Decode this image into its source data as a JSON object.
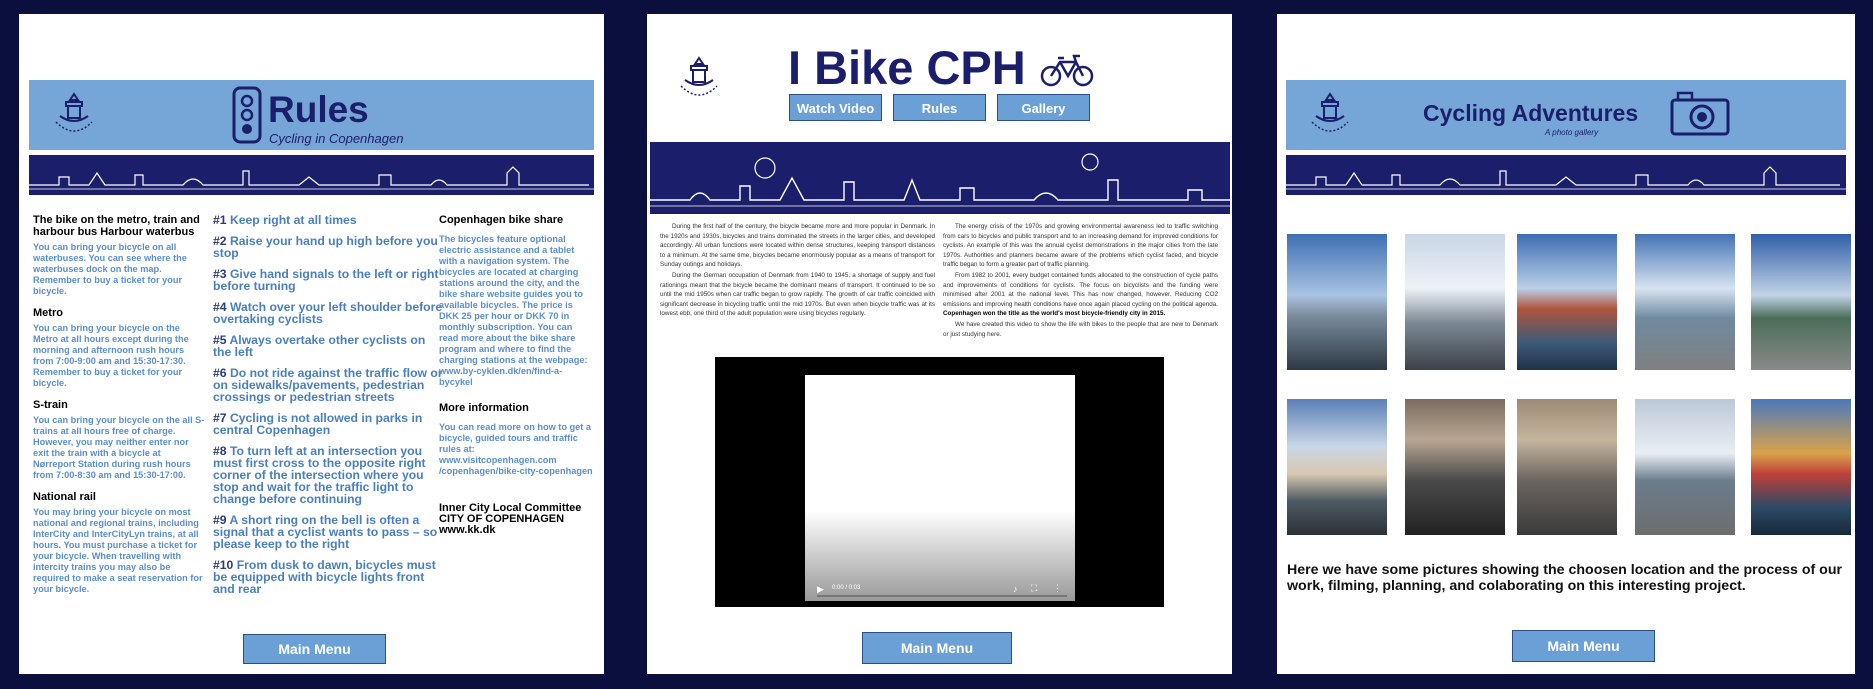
{
  "rules_page": {
    "title": "Rules",
    "subtitle": "Cycling in Copenhagen",
    "left_sections": [
      {
        "title": "The bike on the metro, train and harbour bus Harbour waterbus",
        "body": "You can bring your bicycle on all waterbuses. You can see where the waterbuses dock on the map. Remember to buy a ticket for your bicycle."
      },
      {
        "title": "Metro",
        "body": "You can bring your bicycle on the Metro at all hours except during the morning and afternoon rush hours from 7:00-9:00 am and 15:30-17:30. Remember to buy a ticket for your bicycle."
      },
      {
        "title": "S-train",
        "body": "You can bring your bicycle on the all S-trains at all hours free of charge. However, you may neither enter nor exit the train with a bicycle at Nørreport Station during rush hours from 7:00-8:30 am and 15:30-17:00."
      },
      {
        "title": "National rail",
        "body": "You may bring your bicycle on most national and regional trains, including InterCity and InterCityLyn trains, at all hours. You must purchase a ticket for your bicycle. When travelling with intercity trains you may also be required to make a seat reservation for your bicycle."
      }
    ],
    "rules": [
      {
        "num": "#1",
        "text": "Keep right at all times"
      },
      {
        "num": "#2",
        "text": "Raise your hand up high before you stop"
      },
      {
        "num": "#3",
        "text": "Give hand signals to the left or right before turning"
      },
      {
        "num": "#4",
        "text": "Watch over your left shoulder before overtaking cyclists"
      },
      {
        "num": "#5",
        "text": "Always overtake other cyclists on the left"
      },
      {
        "num": "#6",
        "text": "Do not ride against the traffic flow or on sidewalks/pavements, pedestrian crossings or pedestrian streets"
      },
      {
        "num": "#7",
        "text": "Cycling is not allowed in parks in central Copenhagen"
      },
      {
        "num": "#8",
        "text": "To turn left at an intersection you must first cross to the opposite right corner of the intersection where you stop and wait for the traffic light to change before continuing"
      },
      {
        "num": "#9",
        "text": "A short ring on the bell is often a signal that a cyclist wants to pass – so please keep to the right"
      },
      {
        "num": "#10",
        "text": "From dusk to dawn, bicycles must be equipped with bicycle lights front and rear"
      }
    ],
    "bike_share_title": "Copenhagen bike share",
    "bike_share_body": "The bicycles feature optional electric assistance and a tablet with a navigation system. The bicycles are located at charging stations around the city, and the bike share website guides you to available bicycles. The price is DKK 25 per hour or DKK 70 in monthly subscription. You can read more about the bike share program and where to find the charging stations at the webpage: www.by-cyklen.dk/en/find-a-bycykel",
    "more_info_title": "More information",
    "more_info_body": "You can read more on how to get a bicycle, guided tours and traffic rules at: www.visitcopenhagen.com /copenhagen/bike-city-copenhagen",
    "committee_line1": "Inner City Local Committee",
    "committee_line2": "CITY OF COPENHAGEN",
    "committee_line3": "www.kk.dk",
    "main_menu": "Main Menu"
  },
  "home_page": {
    "title": "I Bike CPH",
    "nav": [
      "Watch Video",
      "Rules",
      "Gallery"
    ],
    "col1_p1": "During the first half of the century, the bicycle became more and more popular in Denmark. In the 1920s and 1930s, bicycles and trains dominated the streets in the larger cities, and developed accordingly. All urban functions were located within dense structures, keeping transport distances to a minimum. At the same time, bicycles became enormously popular as a means of transport for Sunday outings and holidays.",
    "col1_p2": "During the German occupation of Denmark from 1940 to 1945, a shortage of supply and fuel rationings meant that the bicycle became the dominant means of transport. It continued to be so until the mid 1950s when car traffic began to grow rapidly. The growth of car traffic coincided with significant decrease in bicycling traffic until the mid 1970s. But even when bicycle traffic was at its lowest ebb, one third of the adult population were using bicycles regularly.",
    "col2_p1": "The energy crisis of the 1970s and growing environmental awareness led to traffic switching from cars to bicycles and public transport and to an increasing demand for improved conditions for cyclists. An example of this was the annual cyclist demonstrations in the major cities from the late 1970s. Authorities and planners became aware of the problems which cyclist faced, and bicycle traffic began to form a greater part of traffic planning.",
    "col2_p2": "From 1982 to 2001, every budget contained funds allocated to the construction of cycle paths and improvements of conditions for cyclists. The focus on bicyclists and the funding were minimised after 2001 at the national level. This has now changed, however. Reducing CO2 emissions and improving health conditions have once again placed cycling on the political agenda.",
    "col2_bold": "Copenhagen won the title as the world's most bicycle-friendly city in 2015.",
    "col2_p3": "We have created this video to show the life with bikes to the people that are new to Denmark or just studying here.",
    "video_time": "0:00 / 0:03",
    "main_menu": "Main Menu"
  },
  "gallery_page": {
    "title": "Cycling Adventures",
    "subtitle": "A photo gallery",
    "caption": "Here we have some pictures showing the choosen location and the process of our work, filming, planning, and colaborating on this interesting project.",
    "main_menu": "Main Menu"
  },
  "colors": {
    "navy": "#0b0f3d",
    "header_blue": "#76a5d8",
    "skyline_band": "#1b1f6b",
    "accent_text": "#5b8fc9",
    "title_navy": "#1b1f6b",
    "button": "#6aa0d6"
  }
}
